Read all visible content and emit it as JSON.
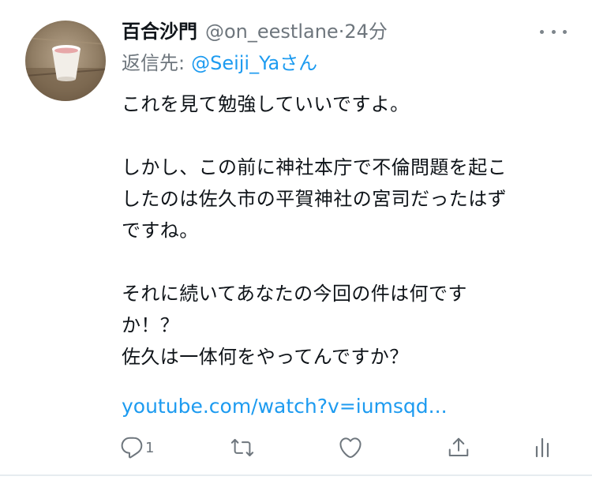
{
  "tweet": {
    "display_name": "百合沙門",
    "handle": "@on_eestlane",
    "separator": "·",
    "timestamp": "24分",
    "reply_prefix": "返信先:",
    "reply_mention": "@Seiji_Ya",
    "reply_suffix": "さん",
    "lines": [
      "これを見て勉強していいですよ。",
      "",
      "しかし、この前に神社本庁で不倫問題を起こ",
      "したのは佐久市の平賀神社の宮司だったはず",
      "ですね。",
      "",
      "それに続いてあなたの今回の件は何です",
      "か！？",
      "佐久は一体何をやってんですか？"
    ],
    "link_text": "youtube.com/watch?v=iumsqd..."
  },
  "actions": {
    "reply_count": "1",
    "icons": [
      "reply-icon",
      "retweet-icon",
      "like-icon",
      "share-icon",
      "analytics-icon"
    ]
  },
  "colors": {
    "text": "#0f1419",
    "secondary": "#6e767d",
    "accent": "#1d9bf0"
  }
}
